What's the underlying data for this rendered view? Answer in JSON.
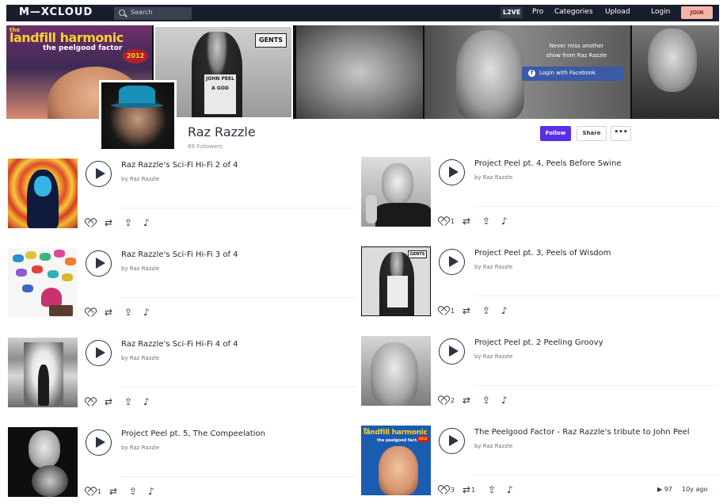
{
  "nav": {
    "logo": "M—XCLOUD",
    "search_placeholder": "Search",
    "live": "L2VE",
    "links": [
      "Pro",
      "Categories",
      "Upload",
      "Login"
    ],
    "join": "JOIN"
  },
  "banner": {
    "cover_top": "the",
    "cover_title": "landfill harmonic",
    "cover_subtitle": "the peelgood factor",
    "cover_year": "2012",
    "sign": "GENTS",
    "shirt_text": "JOHN PEEL A GOD",
    "promo_line1": "Never miss another",
    "promo_line2": "show from Raz Razzle",
    "facebook_button": "Login with Facebook"
  },
  "profile": {
    "name": "Raz Razzle",
    "followers": "89 Followers",
    "follow": "Follow",
    "share": "Share",
    "more": "•••"
  },
  "shows": [
    {
      "title": "Raz Razzle's Sci-Fi Hi-Fi 2 of 4",
      "by": "by Raz Razzle",
      "likes": "",
      "reposts": ""
    },
    {
      "title": "Project Peel pt. 4, Peels Before Swine",
      "by": "by Raz Razzle",
      "likes": "1",
      "reposts": ""
    },
    {
      "title": "Raz Razzle's Sci-Fi Hi-Fi 3 of 4",
      "by": "by Raz Razzle",
      "likes": "",
      "reposts": ""
    },
    {
      "title": "Project Peel pt. 3, Peels of Wisdom",
      "by": "by Raz Razzle",
      "likes": "1",
      "reposts": ""
    },
    {
      "title": "Raz Razzle's Sci-Fi Hi-Fi 4 of 4",
      "by": "by Raz Razzle",
      "likes": "",
      "reposts": ""
    },
    {
      "title": "Project Peel pt. 2 Peeling Groovy",
      "by": "by Raz Razzle",
      "likes": "2",
      "reposts": ""
    },
    {
      "title": "Project Peel pt. 5, The Compeelation",
      "by": "by Raz Razzle",
      "likes": "1",
      "reposts": ""
    },
    {
      "title": "The Peelgood Factor - Raz Razzle's tribute to John Peel",
      "by": "by Raz Razzle",
      "likes": "3",
      "reposts": "1",
      "plays": "97",
      "age": "10y ago"
    }
  ],
  "colors": {
    "nav_bg": "#191e2e",
    "follow_accent": "#5a2de8",
    "join_bg": "#f3b4a8",
    "facebook": "#3a59a7"
  }
}
